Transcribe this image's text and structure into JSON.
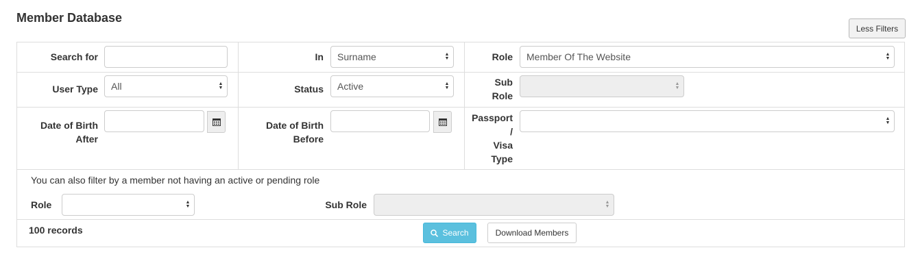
{
  "header": {
    "title": "Member Database",
    "less_filters_label": "Less Filters"
  },
  "filters": {
    "search_for": {
      "label": "Search for",
      "value": ""
    },
    "in": {
      "label": "In",
      "value": "Surname"
    },
    "role": {
      "label": "Role",
      "value": "Member Of The Website"
    },
    "user_type": {
      "label": "User Type",
      "value": "All"
    },
    "status": {
      "label": "Status",
      "value": "Active"
    },
    "sub_role": {
      "label_line1": "Sub",
      "label_line2": "Role",
      "value": ""
    },
    "dob_after": {
      "label_line1": "Date of Birth",
      "label_line2": "After",
      "value": ""
    },
    "dob_before": {
      "label_line1": "Date of Birth",
      "label_line2": "Before",
      "value": ""
    },
    "passport": {
      "label_line1": "Passport",
      "label_line2": "/",
      "label_line3": "Visa",
      "label_line4": "Type",
      "value": ""
    }
  },
  "no_role_filter": {
    "note": "You can also filter by a member not having an active or pending role",
    "role_label": "Role",
    "role_value": "",
    "sub_role_label": "Sub Role",
    "sub_role_value": ""
  },
  "footer": {
    "records": "100 records",
    "search_label": "Search",
    "download_label": "Download Members"
  },
  "icons": {
    "calendar": "calendar-icon",
    "search": "search-icon",
    "select_arrows": "select-arrows-icon"
  },
  "colors": {
    "search_button": "#5bc0de",
    "border": "#dddddd"
  }
}
